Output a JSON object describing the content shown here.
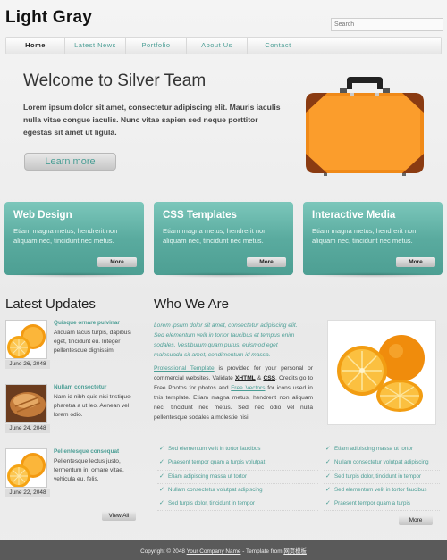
{
  "site": {
    "title": "Light Gray"
  },
  "search": {
    "placeholder": "Search"
  },
  "nav": [
    {
      "label": "Home"
    },
    {
      "label": "Latest News"
    },
    {
      "label": "Portfolio"
    },
    {
      "label": "About Us"
    },
    {
      "label": "Contact"
    }
  ],
  "hero": {
    "title": "Welcome to Silver Team",
    "text": "Lorem ipsum dolor sit amet, consectetur adipiscing elit. Mauris iaculis nulla vitae congue iaculis. Nunc vitae sapien sed neque porttitor egestas sit amet ut ligula.",
    "button": "Learn more"
  },
  "boxes": [
    {
      "title": "Web Design",
      "text": "Etiam magna metus, hendrerit non aliquam nec, tincidunt nec metus.",
      "more": "More"
    },
    {
      "title": "CSS Templates",
      "text": "Etiam magna metus, hendrerit non aliquam nec, tincidunt nec metus.",
      "more": "More"
    },
    {
      "title": "Interactive Media",
      "text": "Etiam magna metus, hendrerit non aliquam nec, tincidunt nec metus.",
      "more": "More"
    }
  ],
  "updates": {
    "heading": "Latest Updates",
    "items": [
      {
        "title": "Quisque ornare pulvinar",
        "text": "Aliquam lacus turpis, dapibus eget, tincidunt eu. Integer pellentesque dignissim.",
        "date": "June 26, 2048"
      },
      {
        "title": "Nullam consectetur",
        "text": "Nam id nibh quis nisi tristique pharetra a ut leo. Aenean vel lorem odio.",
        "date": "June 24, 2048"
      },
      {
        "title": "Pellentesque consequat",
        "text": "Pellentesque lectus justo, fermentum in, ornare vitae, vehicula eu, felis.",
        "date": "June 22, 2048"
      }
    ],
    "view_all": "View All"
  },
  "who": {
    "heading": "Who We Are",
    "italic": "Lorem ipsum dolor sit amet, consectetur adipiscing elit. Sed elementum velit in tortor faucibus et tempus enim sodales. Vestibulum quam purus, euismod eget malesuada sit amet, condimentum id massa.",
    "p1": "Professional Template",
    "p2": " is provided for your personal or commercial websites. Validate ",
    "p3": "XHTML",
    "p4": " & ",
    "p5": "CSS",
    "p6": ". Credits go to Free Photos for photos and ",
    "p7": "Free Vectors",
    "p8": " for icons used in this template. Etiam magna metus, hendrerit non aliquam nec, tincidunt nec metus. Sed nec odio vel nulla pellentesque sodales a molestie nisi.",
    "list_left": [
      "Sed elementum velit in tortor faucibus",
      "Praesent tempor quam a turpis volutpat",
      "Etiam adipiscing massa ut tortor",
      "Nullam consectetur volutpat adipiscing",
      "Sed turpis dolor, tincidunt in tempor"
    ],
    "list_right": [
      "Etiam adipiscing massa ut tortor",
      "Nullam consectetur volutpat adipiscing",
      "Sed turpis dolor, tincidunt in tempor",
      "Sed elementum velit in tortor faucibus",
      "Praesent tempor quam a turpis"
    ],
    "more": "More"
  },
  "footer": {
    "prefix": "Copyright © 2048 ",
    "company": "Your Company Name",
    "middle": " - Template from ",
    "source": "网页模板"
  },
  "colors": {
    "accent": "#4b9e95",
    "box": "#5fb0a4",
    "footer": "#5a5a5a"
  }
}
